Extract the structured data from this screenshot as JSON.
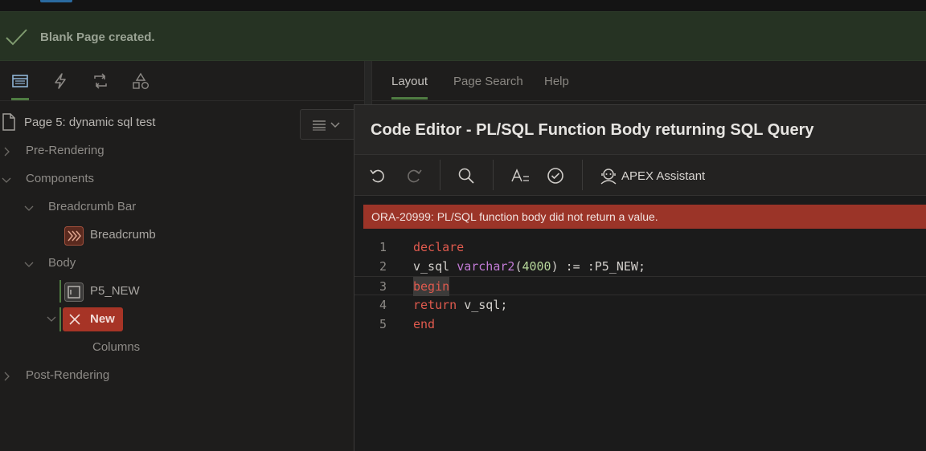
{
  "banner": {
    "message": "Blank Page created.",
    "icon": "checkmark-icon"
  },
  "left_tabs": [
    {
      "name": "rendering-tab",
      "icon": "rendering-icon",
      "active": true
    },
    {
      "name": "dynamic-actions-tab",
      "icon": "lightning-icon",
      "active": false
    },
    {
      "name": "processing-tab",
      "icon": "refresh-icon",
      "active": false
    },
    {
      "name": "shared-components-tab",
      "icon": "shapes-icon",
      "active": false
    }
  ],
  "tree": {
    "page_title": "Page 5: dynamic sql test",
    "pre_rendering": "Pre-Rendering",
    "components": "Components",
    "breadcrumb_bar": "Breadcrumb Bar",
    "breadcrumb": "Breadcrumb",
    "body": "Body",
    "p5_new": "P5_NEW",
    "new_region": "New",
    "columns": "Columns",
    "post_rendering": "Post-Rendering"
  },
  "right_tabs": [
    {
      "label": "Layout",
      "active": true
    },
    {
      "label": "Page Search",
      "active": false
    },
    {
      "label": "Help",
      "active": false
    }
  ],
  "dialog": {
    "title": "Code Editor - PL/SQL Function Body returning SQL Query",
    "toolbar": {
      "undo": "undo-icon",
      "redo": "redo-icon",
      "search": "search-icon",
      "font": "font-size-icon",
      "validate": "validate-icon",
      "assistant_label": "APEX Assistant"
    },
    "error": "ORA-20999: PL/SQL function body did not return a value.",
    "code_lines": [
      {
        "n": "1",
        "text": "declare"
      },
      {
        "n": "2",
        "text": "v_sql varchar2(4000) := :P5_NEW;"
      },
      {
        "n": "3",
        "text": "begin"
      },
      {
        "n": "4",
        "text": "return v_sql;"
      },
      {
        "n": "5",
        "text": "end"
      }
    ],
    "current_line": "3"
  },
  "colors": {
    "accent_green": "#4f7c42",
    "error_red": "#9b3428",
    "selection_red": "#a73426"
  }
}
